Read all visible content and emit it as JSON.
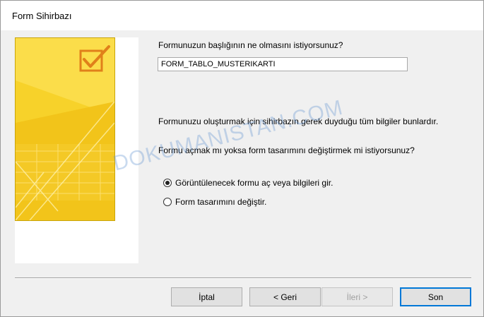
{
  "window": {
    "title": "Form Sihirbazı"
  },
  "form": {
    "title_prompt": "Formunuzun başlığının ne olmasını istiyorsunuz?",
    "title_value": "FORM_TABLO_MUSTERIKARTI",
    "info_text": "Formunuzu oluşturmak için sihirbazın gerek duyduğu tüm bilgiler bunlardır.",
    "open_prompt": "Formu açmak mı yoksa form tasarımını değiştirmek mi istiyorsunuz?",
    "options": [
      {
        "label": "Görüntülenecek formu aç veya bilgileri gir.",
        "checked": true
      },
      {
        "label": "Form tasarımını değiştir.",
        "checked": false
      }
    ]
  },
  "buttons": {
    "cancel": "İptal",
    "back": "< Geri",
    "next": "İleri >",
    "finish": "Son"
  },
  "watermark": "DOKUMANISTAN.COM",
  "colors": {
    "art_yellow": "#f7d22a",
    "art_light": "#ffe87a",
    "art_dark": "#e6b800",
    "accent_border": "#0078d7"
  },
  "icons": {
    "side_art": "checkmark-box-icon"
  }
}
